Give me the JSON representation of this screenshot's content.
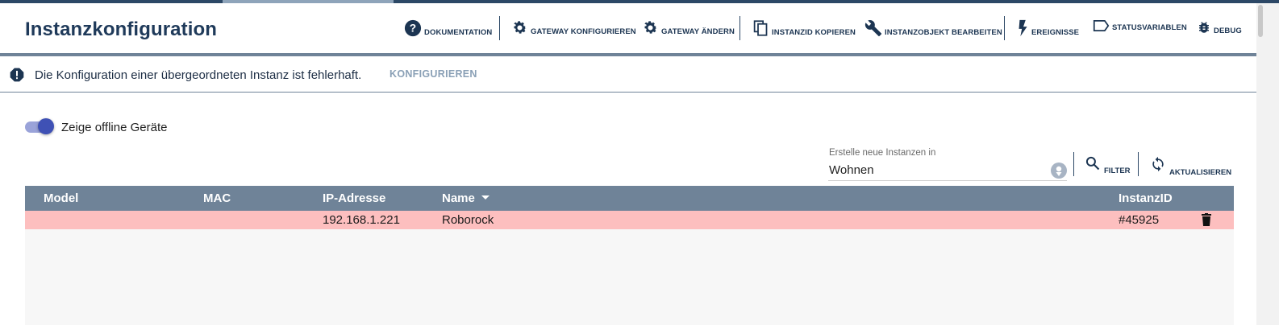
{
  "header": {
    "title": "Instanzkonfiguration",
    "toolbar": [
      {
        "id": "documentation",
        "label": "Dokumentation",
        "icon": "help-circle-icon"
      },
      {
        "id": "configure-gateway",
        "label": "Gateway konfigurieren",
        "icon": "gear-icon"
      },
      {
        "id": "change-gateway",
        "label": "Gateway ändern",
        "icon": "gear-icon"
      },
      {
        "id": "copy-instance-id",
        "label": "InstanzID kopieren",
        "icon": "copy-icon"
      },
      {
        "id": "edit-instance-object",
        "label": "Instanzobjekt bearbeiten",
        "icon": "wrench-icon"
      },
      {
        "id": "events",
        "label": "Ereignisse",
        "icon": "lightning-icon"
      },
      {
        "id": "status-variables",
        "label": "Statusvariablen",
        "icon": "tag-icon"
      },
      {
        "id": "debug",
        "label": "Debug",
        "icon": "bug-icon"
      }
    ]
  },
  "alert": {
    "icon": "alert-octagon-icon",
    "message": "Die Konfiguration einer übergeordneten Instanz ist fehlerhaft.",
    "action": "KONFIGURIEREN"
  },
  "options": {
    "show_offline_label": "Zeige offline Geräte",
    "show_offline": true
  },
  "create_in": {
    "label": "Erstelle neue Instanzen in",
    "value": "Wohnen"
  },
  "actions": {
    "filter": "Filter",
    "refresh": "Aktualisieren"
  },
  "table": {
    "columns": [
      "Model",
      "MAC",
      "IP-Adresse",
      "Name",
      "InstanzID"
    ],
    "sorted_by": "Name",
    "rows": [
      {
        "model": "",
        "mac": "",
        "ip": "192.168.1.221",
        "name": "Roborock",
        "instance_id": "#45925"
      }
    ]
  },
  "colors": {
    "accent": "#2c4866",
    "header_row": "#6f8398",
    "error_row": "#fdbfbf",
    "toggle": "#3f51b5",
    "link": "#8aa0b6"
  }
}
